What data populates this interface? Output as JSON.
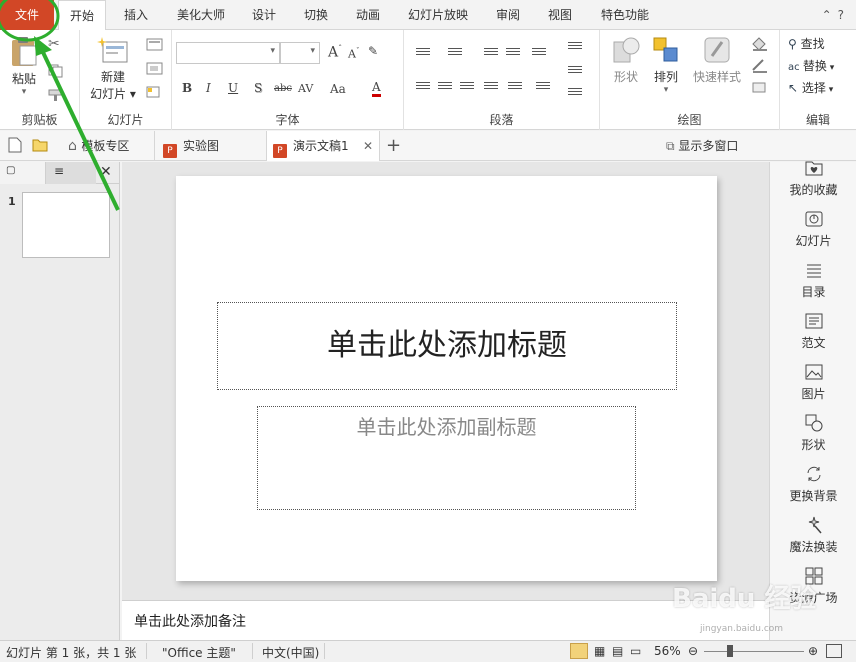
{
  "ribbon_tabs": {
    "file": "文件",
    "items": [
      "开始",
      "插入",
      "美化大师",
      "设计",
      "切换",
      "动画",
      "幻灯片放映",
      "审阅",
      "视图",
      "特色功能"
    ]
  },
  "groups": {
    "clipboard": {
      "label": "剪贴板",
      "paste": "粘贴"
    },
    "slides": {
      "label": "幻灯片",
      "new_slide": "新建",
      "new_slide_line2": "幻灯片 ▾"
    },
    "font": {
      "label": "字体"
    },
    "paragraph": {
      "label": "段落"
    },
    "drawing": {
      "label": "绘图",
      "shapes": "形状",
      "arrange": "排列",
      "quick_styles": "快速样式"
    },
    "editing": {
      "label": "编辑",
      "find": "查找",
      "replace": "替换",
      "select": "选择"
    }
  },
  "font_buttons": [
    "B",
    "I",
    "U",
    "S",
    "abc",
    "AV",
    "Aa",
    "A"
  ],
  "doc_tabs": {
    "templates": "模板专区",
    "tab1": "实验图",
    "tab2": "演示文稿1",
    "multi_window": "显示多窗口"
  },
  "slide": {
    "number": "1",
    "title_placeholder": "单击此处添加标题",
    "subtitle_placeholder": "单击此处添加副标题"
  },
  "notes_placeholder": "单击此处添加备注",
  "sidebar": [
    {
      "label": "我的收藏",
      "icon": "heart-folder-icon"
    },
    {
      "label": "幻灯片",
      "icon": "slide-icon"
    },
    {
      "label": "目录",
      "icon": "list-icon"
    },
    {
      "label": "范文",
      "icon": "document-icon"
    },
    {
      "label": "图片",
      "icon": "image-icon"
    },
    {
      "label": "形状",
      "icon": "shape-icon"
    },
    {
      "label": "更换背景",
      "icon": "refresh-icon"
    },
    {
      "label": "魔法换装",
      "icon": "magic-wand-icon"
    },
    {
      "label": "资源广场",
      "icon": "grid-icon"
    }
  ],
  "status": {
    "slide_info": "幻灯片 第 1 张，共 1 张",
    "theme": "\"Office 主题\"",
    "language": "中文(中国)",
    "zoom": "56%"
  },
  "colors": {
    "file_tab": "#d24726",
    "annotation": "#2eae2e"
  }
}
